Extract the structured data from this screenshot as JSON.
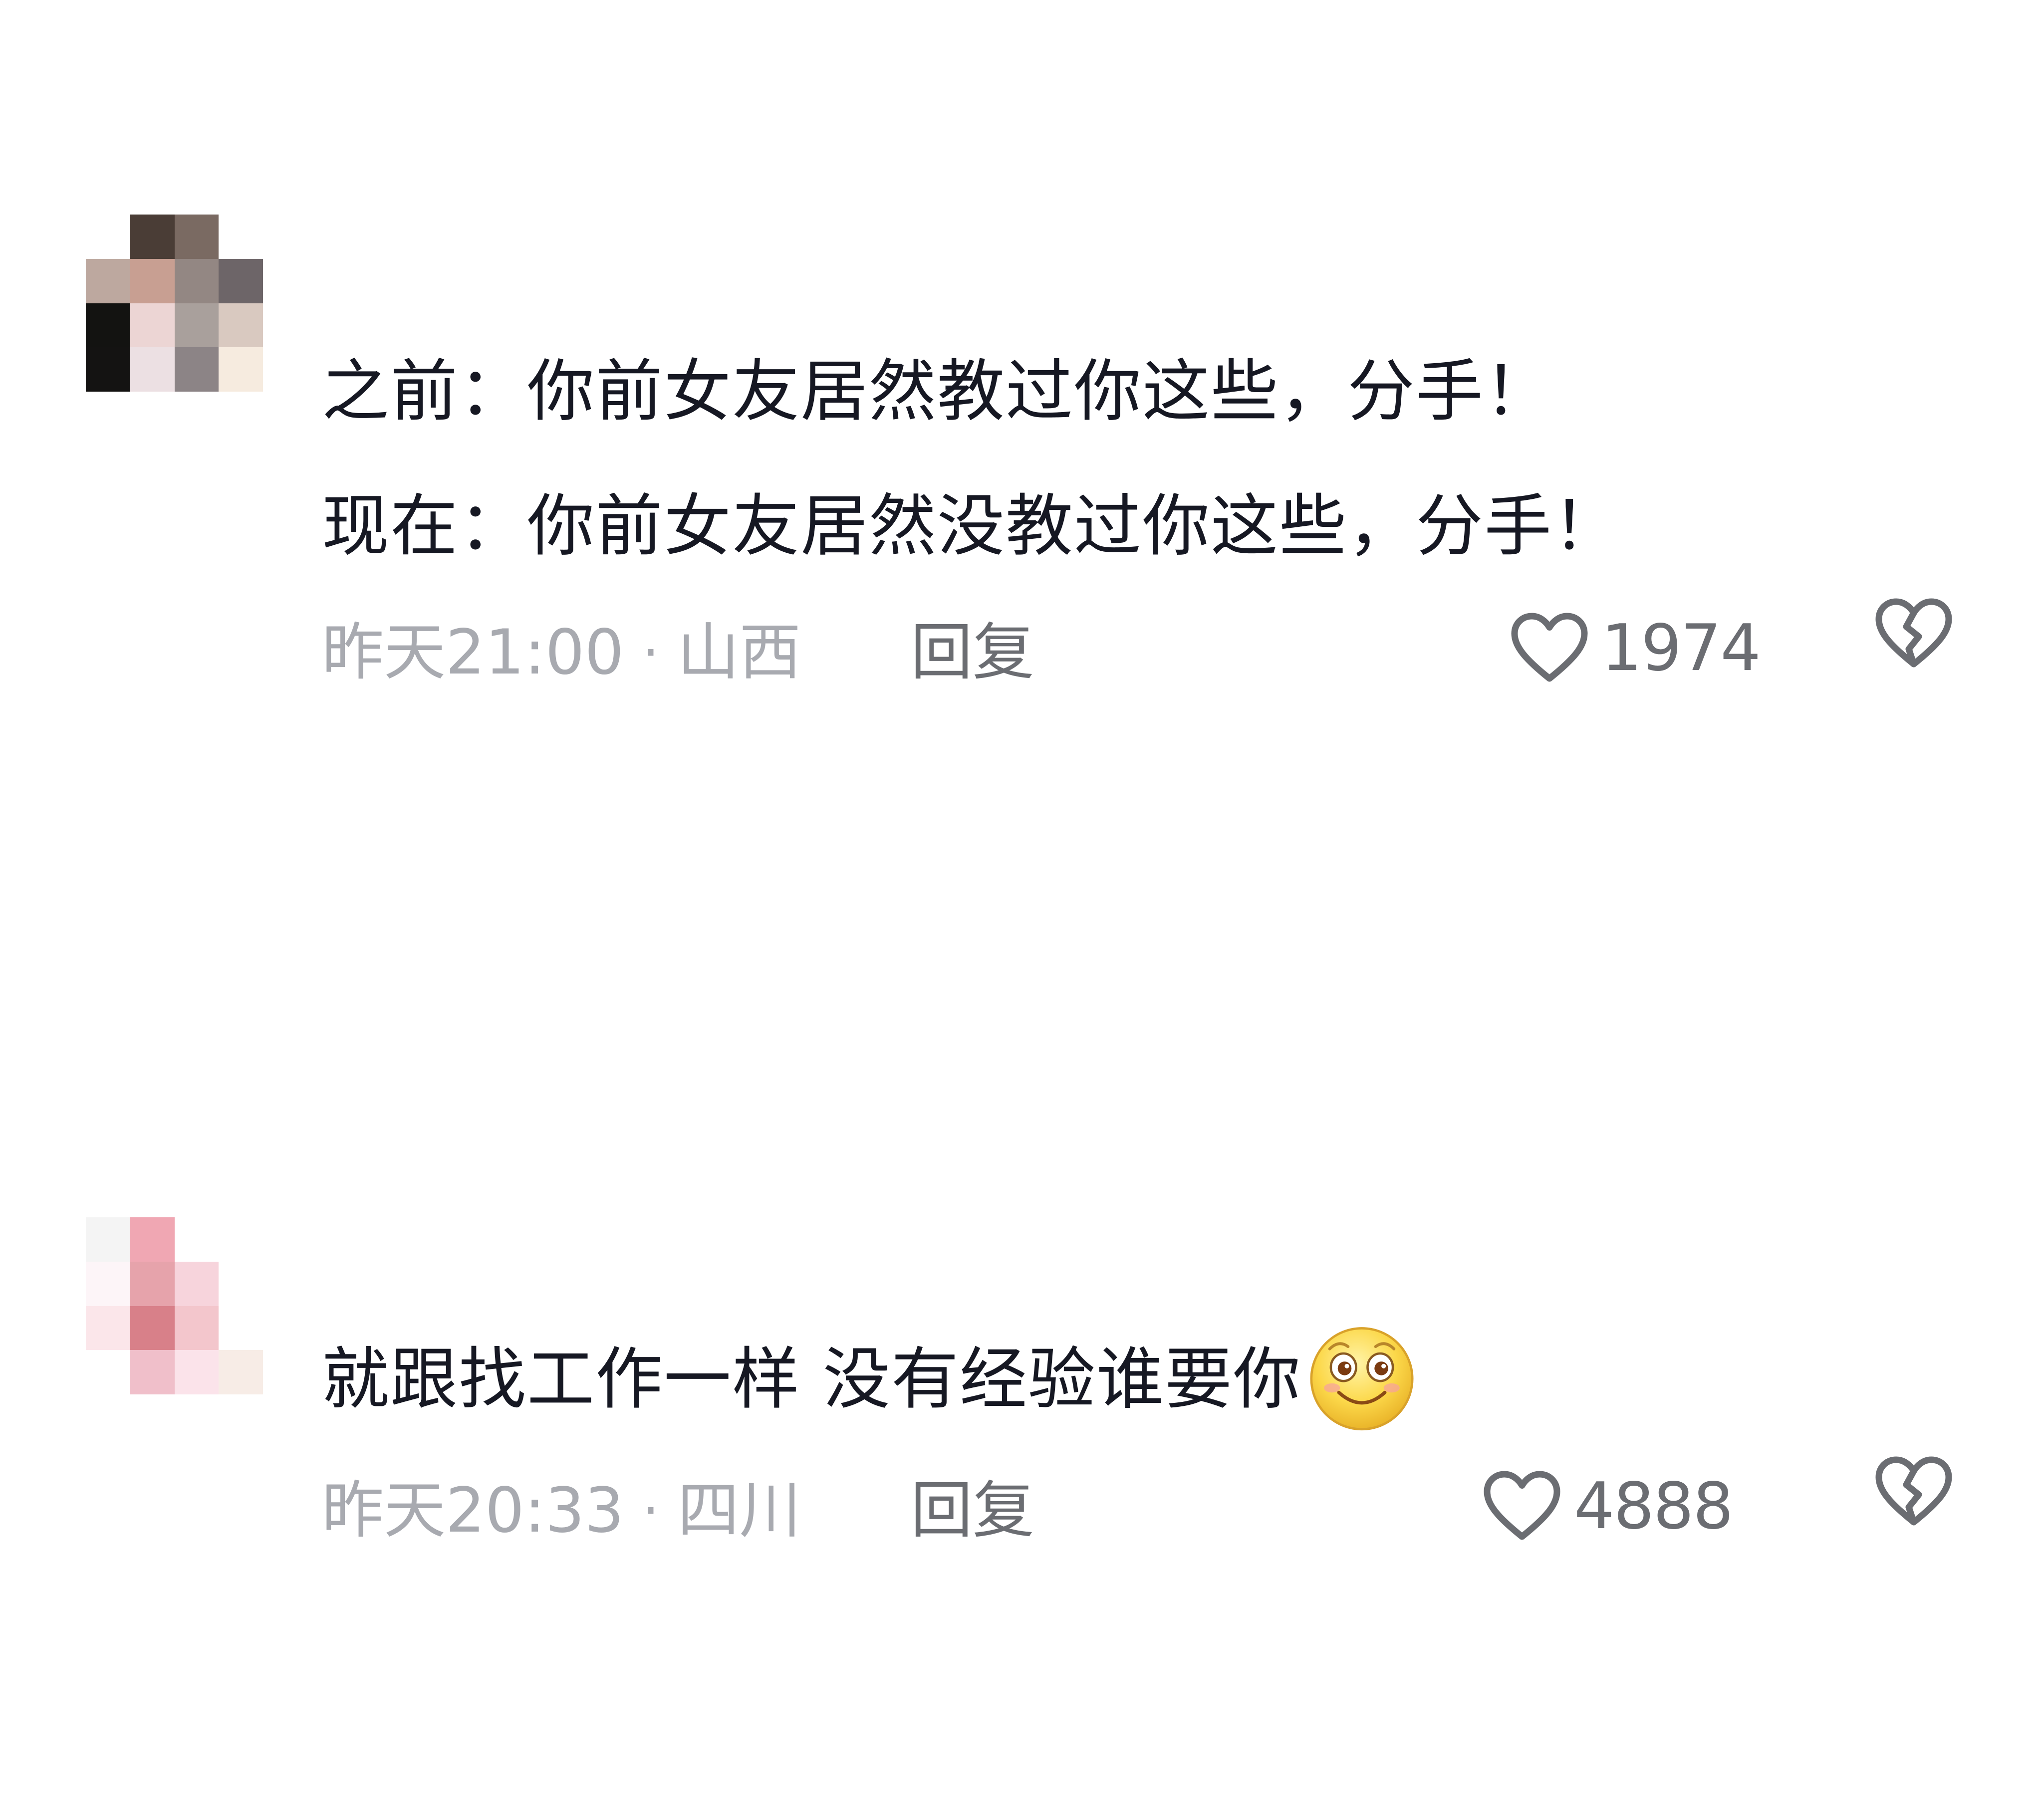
{
  "comments": [
    {
      "avatar_colors": [
        "#ffffff",
        "#4a3d36",
        "#7a6a62",
        "#ffffff",
        "#bda89f",
        "#c89f92",
        "#938783",
        "#6d6568",
        "#131311",
        "#ecd5d4",
        "#a9a09c",
        "#d9c9c0",
        "#141312",
        "#ece0e3",
        "#8c8486",
        "#f6ebdf"
      ],
      "lines": [
        "之前：你前女友居然教过你这些，分手！",
        "现在：你前女友居然没教过你这些，分手！"
      ],
      "time": "昨天21:00",
      "dot": "·",
      "location": "山西",
      "reply_label": "回复",
      "like_count": "1974",
      "like_icon": "heart-outline-icon",
      "dislike_icon": "broken-heart-icon"
    },
    {
      "avatar_colors": [
        "#f4f4f4",
        "#f0a7b3",
        "#ffffff",
        "#ffffff",
        "#fdf5f8",
        "#e6a3ab",
        "#f7d4dc",
        "#ffffff",
        "#fbe6ea",
        "#d88089",
        "#f3c6cc",
        "#ffffff",
        "#ffffff",
        "#f0bfca",
        "#fbe3ea",
        "#f7ece6"
      ],
      "lines": [
        "就跟找工作一样 没有经验谁要你"
      ],
      "emoji": "smiling-face-emoji",
      "time": "昨天20:33",
      "dot": "·",
      "location": "四川",
      "reply_label": "回复",
      "like_count": "4888",
      "like_icon": "heart-outline-icon",
      "dislike_icon": "broken-heart-icon"
    }
  ],
  "colors": {
    "text_primary": "#161823",
    "text_meta": "#a8aab0",
    "icon_gray": "#6b6d72"
  }
}
